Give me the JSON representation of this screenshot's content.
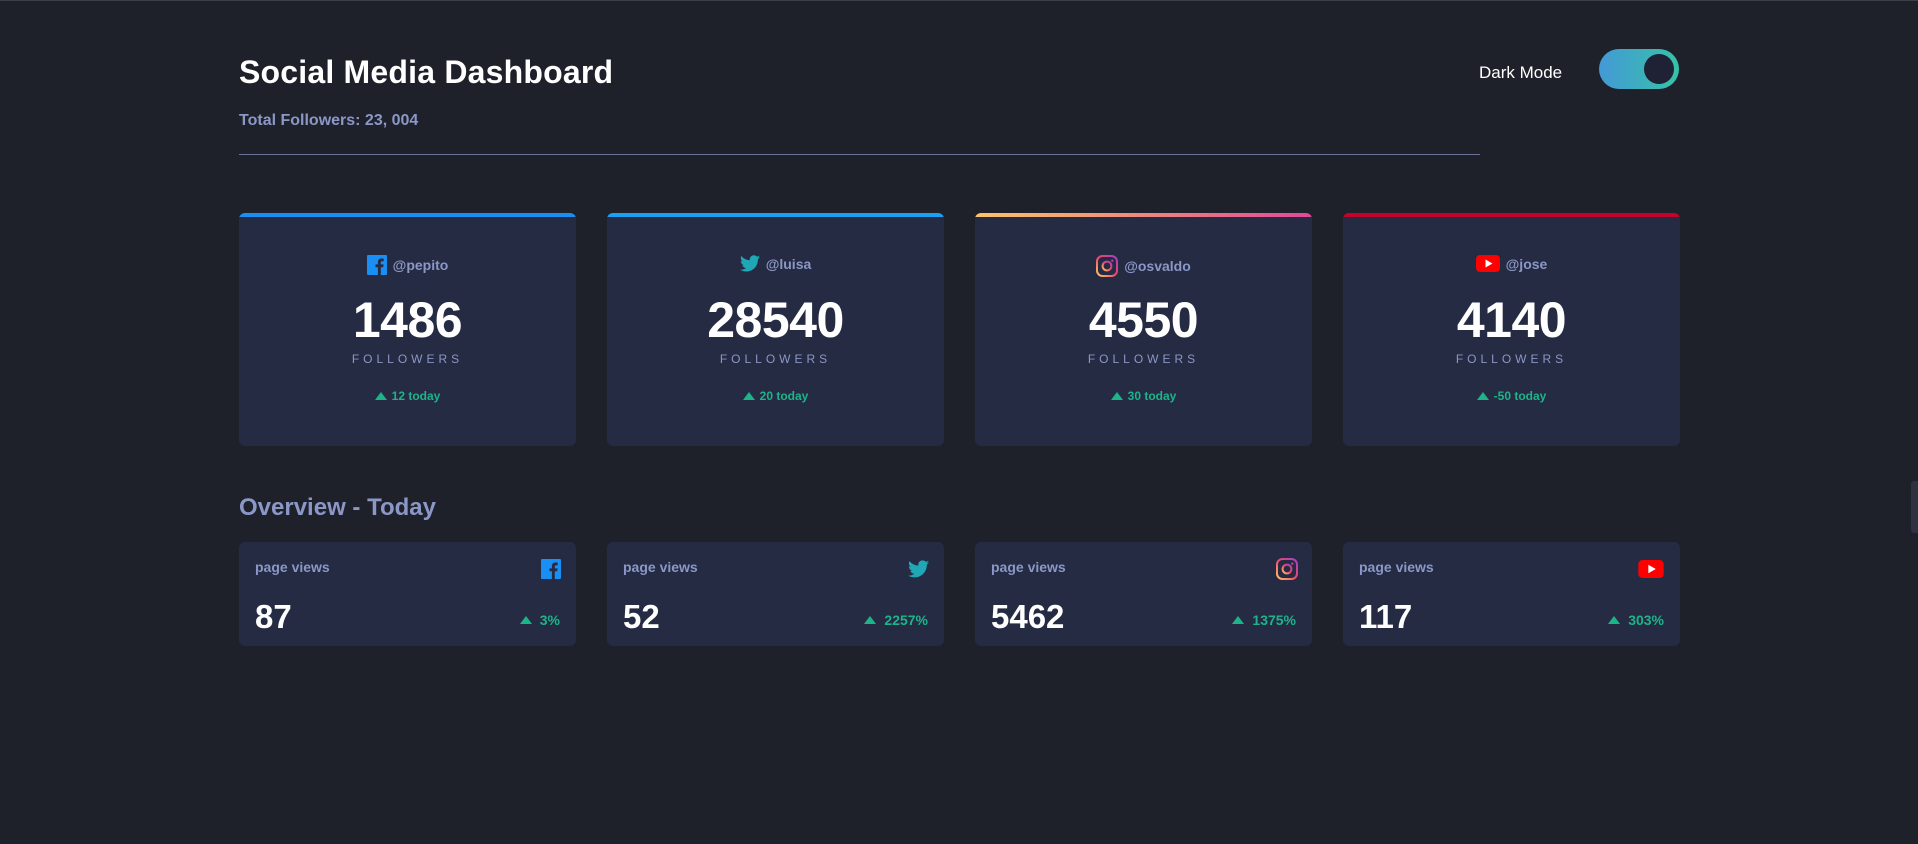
{
  "header": {
    "title": "Social Media Dashboard",
    "total_followers": "Total Followers: 23, 004",
    "mode_label": "Dark Mode",
    "dark_mode_on": true
  },
  "cards": [
    {
      "platform": "facebook",
      "icon": "facebook-icon",
      "handle": "@pepito",
      "count": "1486",
      "label": "FOLLOWERS",
      "today": "12 today",
      "accent": "#198ff5"
    },
    {
      "platform": "twitter",
      "icon": "twitter-icon",
      "handle": "@luisa",
      "count": "28540",
      "label": "FOLLOWERS",
      "today": "20 today",
      "accent": "#1ca0f2"
    },
    {
      "platform": "instagram",
      "icon": "instagram-icon",
      "handle": "@osvaldo",
      "count": "4550",
      "label": "FOLLOWERS",
      "today": "30 today",
      "accent": "#df4996"
    },
    {
      "platform": "youtube",
      "icon": "youtube-icon",
      "handle": "@jose",
      "count": "4140",
      "label": "FOLLOWERS",
      "today": "-50 today",
      "accent": "#c4032a"
    }
  ],
  "overview": {
    "title": "Overview - Today",
    "items": [
      {
        "platform": "facebook",
        "icon": "facebook-icon",
        "label": "page views",
        "value": "87",
        "change": "3%"
      },
      {
        "platform": "twitter",
        "icon": "twitter-icon",
        "label": "page views",
        "value": "52",
        "change": "2257%"
      },
      {
        "platform": "instagram",
        "icon": "instagram-icon",
        "label": "page views",
        "value": "5462",
        "change": "1375%"
      },
      {
        "platform": "youtube",
        "icon": "youtube-icon",
        "label": "page views",
        "value": "117",
        "change": "303%"
      }
    ]
  },
  "colors": {
    "background": "#1e202a",
    "card": "#252b43",
    "muted_text": "#8b97c6",
    "positive": "#1db489"
  }
}
